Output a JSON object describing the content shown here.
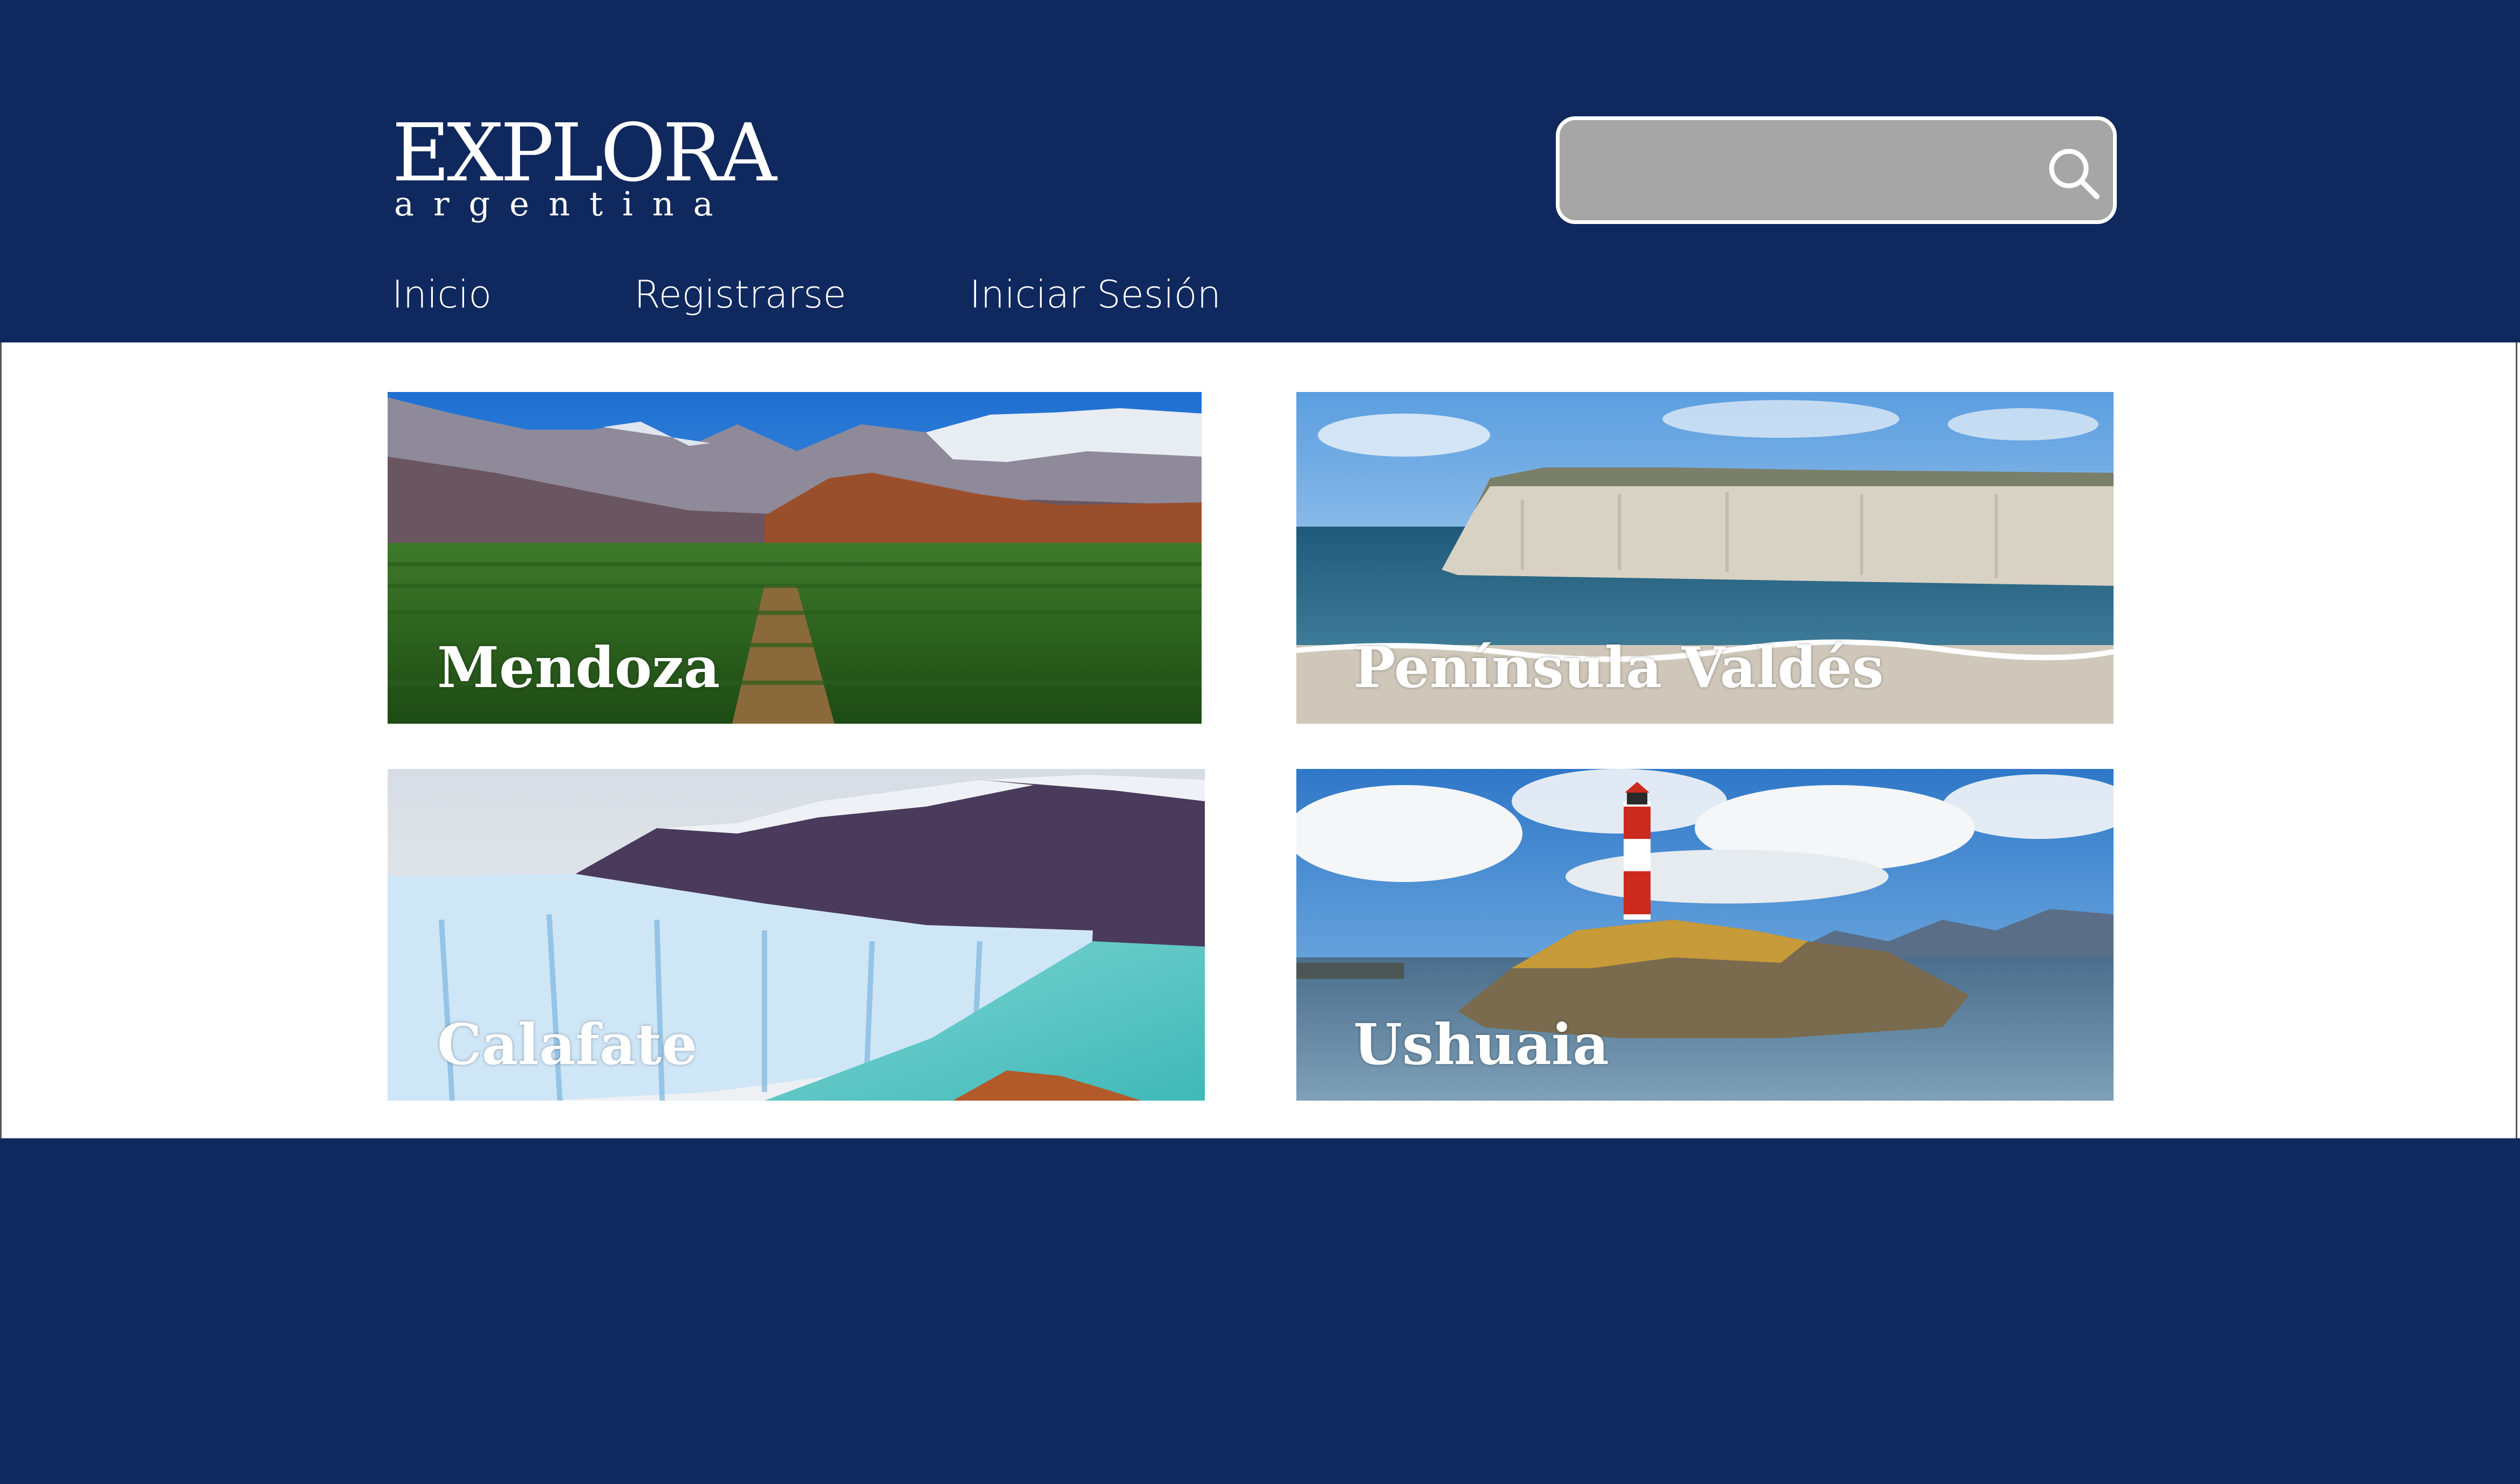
{
  "brand": {
    "logo_main": "EXPLORA",
    "logo_sub": "argentina"
  },
  "search": {
    "value": "",
    "placeholder": "",
    "icon": "search-icon"
  },
  "nav": {
    "items": [
      {
        "label": "Inicio"
      },
      {
        "label": "Registrarse"
      },
      {
        "label": "Iniciar Sesión"
      }
    ]
  },
  "destinations": [
    {
      "label": "Mendoza",
      "image": "vineyard-mountains"
    },
    {
      "label": "Península Valdés",
      "image": "coastal-cliffs"
    },
    {
      "label": "Calafate",
      "image": "glacier-lake"
    },
    {
      "label": "Ushuaia",
      "image": "lighthouse-island"
    }
  ],
  "colors": {
    "header_bg": "#0f285e",
    "footer_bg": "#0f285e",
    "search_bg": "#a6a6a6",
    "text": "#ffffff"
  }
}
